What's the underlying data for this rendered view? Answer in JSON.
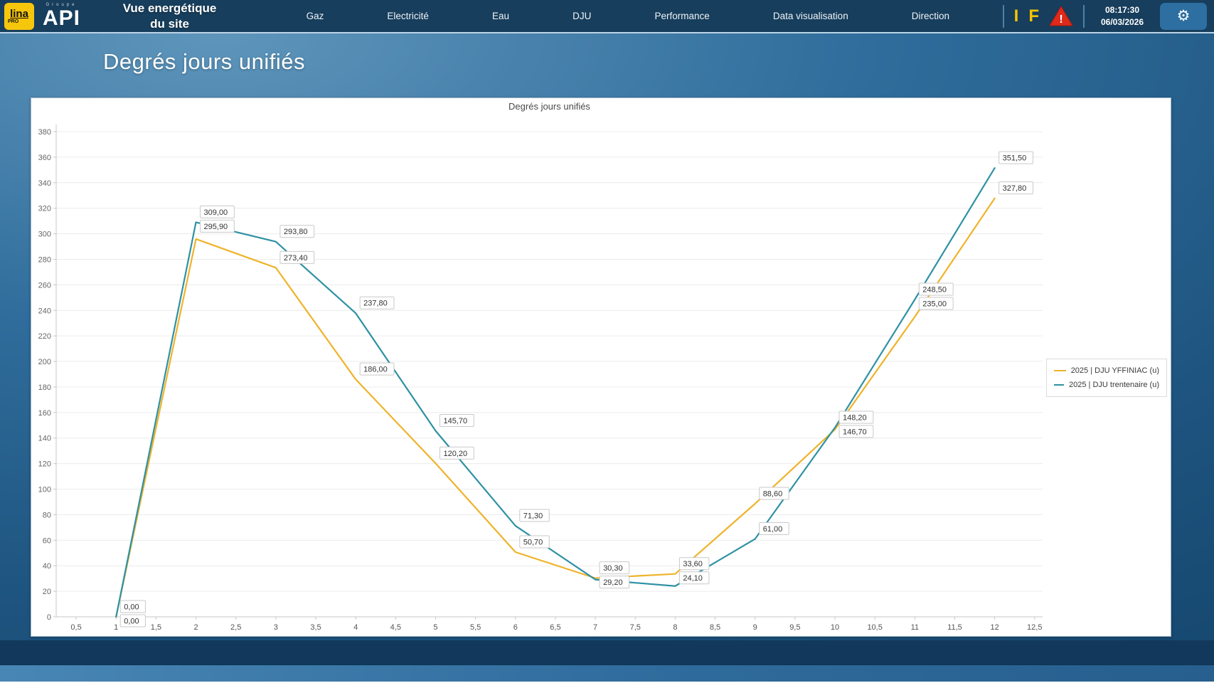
{
  "header": {
    "logo_lina": {
      "text": "lina",
      "sub": "PRO"
    },
    "logo_api": {
      "top": "Groupe",
      "text": "API"
    },
    "app_title_line1": "Vue energétique",
    "app_title_line2": "du site",
    "nav": [
      "Gaz",
      "Electricité",
      "Eau",
      "DJU",
      "Performance",
      "Data visualisation",
      "Direction"
    ],
    "indicators": {
      "i": "I",
      "f": "F"
    },
    "time": "08:17:30",
    "date": "06/03/2026"
  },
  "icons": {
    "gear": "⚙",
    "warning": "!"
  },
  "page": {
    "title": "Degrés jours unifiés"
  },
  "chart_data": {
    "type": "line",
    "title": "Degrés jours unifiés",
    "x": [
      1,
      2,
      3,
      4,
      5,
      6,
      7,
      8,
      9,
      10,
      11,
      12
    ],
    "xlim": [
      0.25,
      12.6
    ],
    "ylim": [
      0,
      380
    ],
    "y_tick_step": 20,
    "x_tick_values": [
      0.5,
      1,
      1.5,
      2,
      2.5,
      3,
      3.5,
      4,
      4.5,
      5,
      5.5,
      6,
      6.5,
      7,
      7.5,
      8,
      8.5,
      9,
      9.5,
      10,
      10.5,
      11,
      11.5,
      12,
      12.5
    ],
    "x_tick_labels": [
      "0,5",
      "1",
      "1,5",
      "2",
      "2,5",
      "3",
      "3,5",
      "4",
      "4,5",
      "5",
      "5,5",
      "6",
      "6,5",
      "7",
      "7,5",
      "8",
      "8,5",
      "9",
      "9,5",
      "10",
      "10,5",
      "11",
      "11,5",
      "12",
      "12,5"
    ],
    "y_tick_labels": [
      "0",
      "20",
      "40",
      "60",
      "80",
      "100",
      "120",
      "140",
      "160",
      "180",
      "200",
      "220",
      "240",
      "260",
      "280",
      "300",
      "320",
      "340",
      "360",
      "380"
    ],
    "grid": "horizontal",
    "legend_position": "right",
    "series": [
      {
        "name": "2025 | DJU YFFINIAC (u)",
        "color": "#EFB32A",
        "values": [
          0,
          295.9,
          273.4,
          186.0,
          120.2,
          50.7,
          30.3,
          33.6,
          88.6,
          146.7,
          235.0,
          327.8
        ],
        "labels": [
          "0,00",
          "295,90",
          "273,40",
          "186,00",
          "120,20",
          "50,70",
          "30,30",
          "33,60",
          "88,60",
          "146,70",
          "235,00",
          "327,80"
        ]
      },
      {
        "name": "2025 | DJU trentenaire (u)",
        "color": "#2E91A4",
        "values": [
          0,
          309.0,
          293.8,
          237.8,
          145.7,
          71.3,
          29.2,
          24.1,
          61.0,
          148.2,
          248.5,
          351.5
        ],
        "labels": [
          "0,00",
          "309,00",
          "293,80",
          "237,80",
          "145,70",
          "71,30",
          "29,20",
          "24,10",
          "61,00",
          "148,20",
          "248,50",
          "351,50"
        ]
      }
    ]
  }
}
